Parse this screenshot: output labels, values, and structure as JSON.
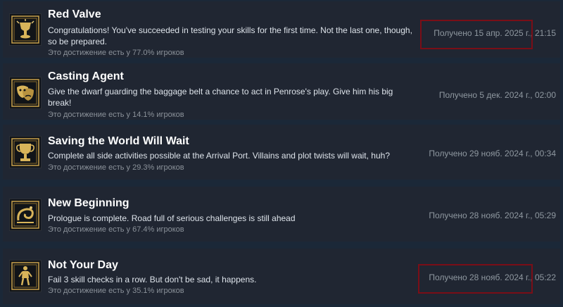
{
  "achievements": [
    {
      "title": "Red Valve",
      "description": "Congratulations! You've succeeded in testing your skills for the first time. Not the last one, though, so be prepared.",
      "percent": "Это достижение есть у 77.0% игроков",
      "unlocked": "Получено 15 апр. 2025 г., 21:15",
      "icon": "chalice-icon"
    },
    {
      "title": "Casting Agent",
      "description": "Give the dwarf guarding the baggage belt a chance to act in Penrose's play. Give him his big break!",
      "percent": "Это достижение есть у 14.1% игроков",
      "unlocked": "Получено 5 дек. 2024 г., 02:00",
      "icon": "theater-masks-icon"
    },
    {
      "title": "Saving the World Will Wait",
      "description": "Complete all side activities possible at the Arrival Port. Villains and plot twists will wait, huh?",
      "percent": "Это достижение есть у 29.3% игроков",
      "unlocked": "Получено 29 нояб. 2024 г., 00:34",
      "icon": "trophy-icon"
    },
    {
      "title": "New Beginning",
      "description": "Prologue is complete. Road full of serious challenges is still ahead",
      "percent": "Это достижение есть у 67.4% игроков",
      "unlocked": "Получено 28 нояб. 2024 г., 05:29",
      "icon": "spiral-emblem-icon"
    },
    {
      "title": "Not Your Day",
      "description": "Fail 3 skill checks in a row. But don't be sad, it happens.",
      "percent": "Это достижение есть у 35.1% игроков",
      "unlocked": "Получено 28 нояб. 2024 г., 05:22",
      "icon": "fallen-figure-icon"
    }
  ],
  "colors": {
    "background": "#1b2838",
    "row": "#202632",
    "icon_gold": "#c9a24a",
    "highlight": "#7a0e17"
  }
}
